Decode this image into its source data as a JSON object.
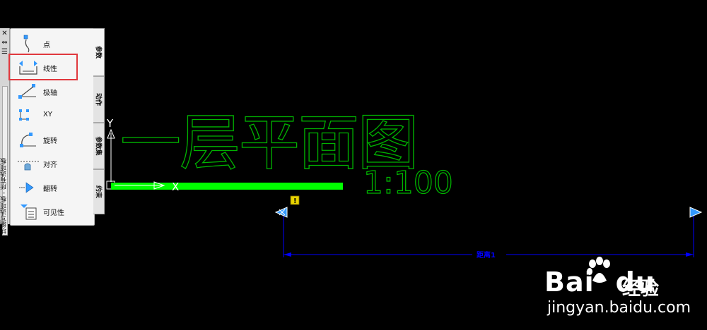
{
  "drawing": {
    "title_text": "一层平面图",
    "scale_text": "1:100",
    "dimension_label": "距离1",
    "warning_badge": "!",
    "axis_y_label": "Y",
    "axis_x_label": "X",
    "colors": {
      "title": "#00b300",
      "bar": "#00ff00",
      "dimension": "#0000ff",
      "grip": "#3399ff",
      "axis": "#ffffff"
    }
  },
  "palette": {
    "frame_title": "块编写选项板 - 所有选项板",
    "frame_buttons": [
      "✕",
      "⇔",
      "☰"
    ],
    "tools": [
      {
        "label": "点",
        "icon": "point-param-icon"
      },
      {
        "label": "线性",
        "icon": "linear-param-icon"
      },
      {
        "label": "极轴",
        "icon": "polar-param-icon"
      },
      {
        "label": "XY",
        "icon": "xy-param-icon"
      },
      {
        "label": "旋转",
        "icon": "rotation-param-icon"
      },
      {
        "label": "对齐",
        "icon": "alignment-param-icon"
      },
      {
        "label": "翻转",
        "icon": "flip-param-icon"
      },
      {
        "label": "可见性",
        "icon": "visibility-param-icon"
      }
    ],
    "tabs": [
      "参数",
      "动作",
      "参数集",
      "约束"
    ],
    "active_tab": "参数",
    "highlight_color": "#e0383d"
  },
  "watermark": {
    "brand": "Bai",
    "brand_tail": "du",
    "brand_cn": "经验",
    "url": "jingyan.baidu.com"
  }
}
